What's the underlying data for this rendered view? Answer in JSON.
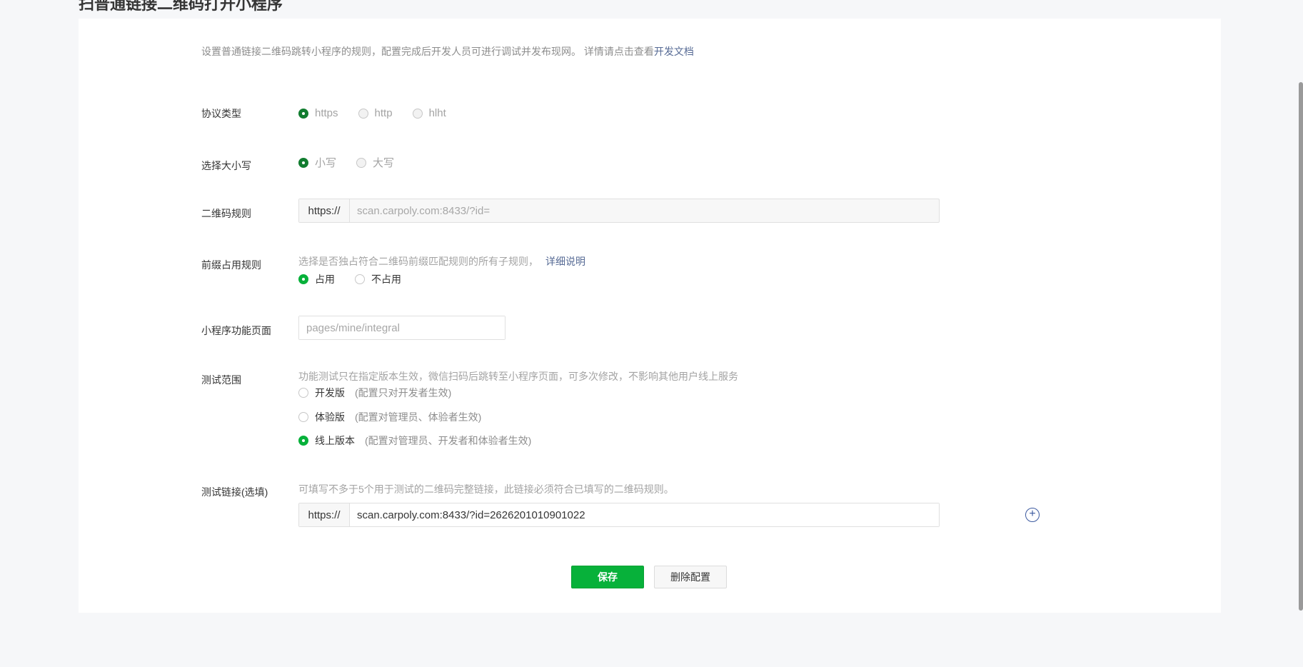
{
  "page": {
    "cut_title": "扫普通链接二维码打开小程序"
  },
  "intro": {
    "text": "设置普通链接二维码跳转小程序的规则，配置完成后开发人员可进行调试并发布现网。 详情请点击查看",
    "link": "开发文档"
  },
  "protocol": {
    "label": "协议类型",
    "options": [
      "https",
      "http",
      "hlht"
    ]
  },
  "case": {
    "label": "选择大小写",
    "options": [
      "小写",
      "大写"
    ]
  },
  "qr_rule": {
    "label": "二维码规则",
    "prefix": "https://",
    "placeholder": "scan.carpoly.com:8433/?id="
  },
  "prefix_rule": {
    "label": "前缀占用规则",
    "description": "选择是否独占符合二维码前缀匹配规则的所有子规则，",
    "link": "详细说明",
    "options": [
      "占用",
      "不占用"
    ]
  },
  "mp_page": {
    "label": "小程序功能页面",
    "placeholder": "pages/mine/integral"
  },
  "test_scope": {
    "label": "测试范围",
    "description": "功能测试只在指定版本生效，微信扫码后跳转至小程序页面，可多次修改，不影响其他用户线上服务",
    "options": [
      {
        "label": "开发版",
        "hint": "(配置只对开发者生效)"
      },
      {
        "label": "体验版",
        "hint": "(配置对管理员、体验者生效)"
      },
      {
        "label": "线上版本",
        "hint": "(配置对管理员、开发者和体验者生效)"
      }
    ]
  },
  "test_link": {
    "label": "测试链接(选填)",
    "description": "可填写不多于5个用于测试的二维码完整链接，此链接必须符合已填写的二维码规则。",
    "prefix": "https://",
    "value": "scan.carpoly.com:8433/?id=2626201010901022",
    "add_icon": "plus-circle-icon"
  },
  "actions": {
    "save": "保存",
    "delete": "删除配置"
  },
  "colors": {
    "primary": "#07b13a",
    "link": "#576b95"
  }
}
